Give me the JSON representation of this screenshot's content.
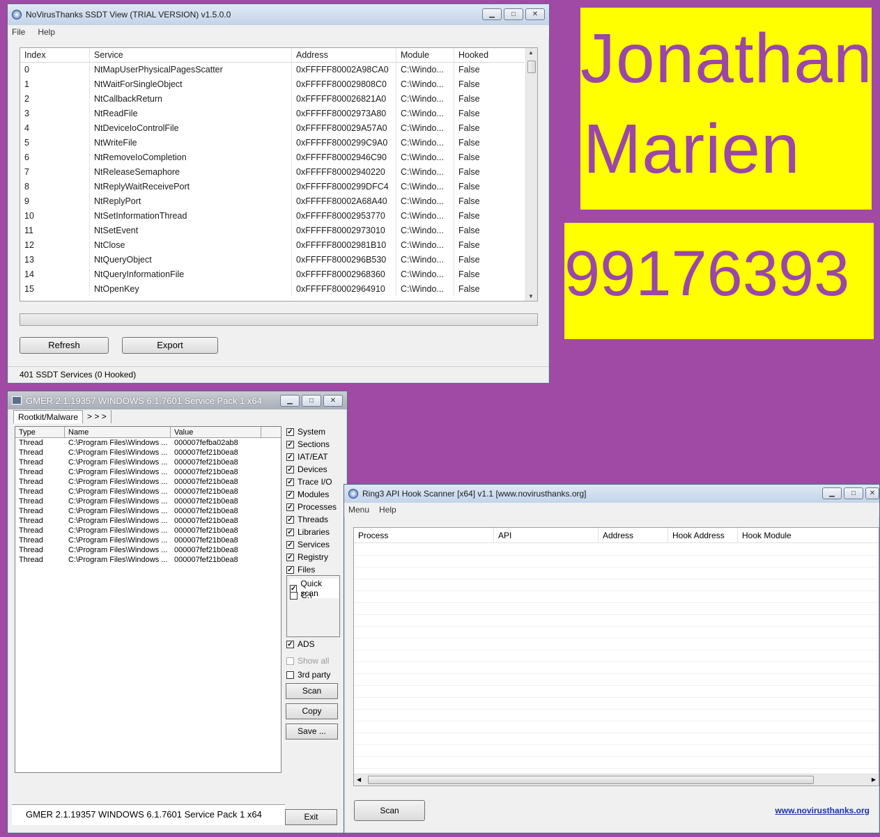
{
  "ssdt": {
    "title": "NoVirusThanks SSDT View (TRIAL VERSION) v1.5.0.0",
    "menu": [
      "File",
      "Help"
    ],
    "columns": [
      "Index",
      "Service",
      "Address",
      "Module",
      "Hooked"
    ],
    "rows": [
      [
        "0",
        "NtMapUserPhysicalPagesScatter",
        "0xFFFFF80002A98CA0",
        "C:\\Windo...",
        "False"
      ],
      [
        "1",
        "NtWaitForSingleObject",
        "0xFFFFF800029808C0",
        "C:\\Windo...",
        "False"
      ],
      [
        "2",
        "NtCallbackReturn",
        "0xFFFFF800026821A0",
        "C:\\Windo...",
        "False"
      ],
      [
        "3",
        "NtReadFile",
        "0xFFFFF80002973A80",
        "C:\\Windo...",
        "False"
      ],
      [
        "4",
        "NtDeviceIoControlFile",
        "0xFFFFF800029A57A0",
        "C:\\Windo...",
        "False"
      ],
      [
        "5",
        "NtWriteFile",
        "0xFFFFF8000299C9A0",
        "C:\\Windo...",
        "False"
      ],
      [
        "6",
        "NtRemoveIoCompletion",
        "0xFFFFF80002946C90",
        "C:\\Windo...",
        "False"
      ],
      [
        "7",
        "NtReleaseSemaphore",
        "0xFFFFF80002940220",
        "C:\\Windo...",
        "False"
      ],
      [
        "8",
        "NtReplyWaitReceivePort",
        "0xFFFFF8000299DFC4",
        "C:\\Windo...",
        "False"
      ],
      [
        "9",
        "NtReplyPort",
        "0xFFFFF80002A68A40",
        "C:\\Windo...",
        "False"
      ],
      [
        "10",
        "NtSetInformationThread",
        "0xFFFFF80002953770",
        "C:\\Windo...",
        "False"
      ],
      [
        "11",
        "NtSetEvent",
        "0xFFFFF80002973010",
        "C:\\Windo...",
        "False"
      ],
      [
        "12",
        "NtClose",
        "0xFFFFF80002981B10",
        "C:\\Windo...",
        "False"
      ],
      [
        "13",
        "NtQueryObject",
        "0xFFFFF8000296B530",
        "C:\\Windo...",
        "False"
      ],
      [
        "14",
        "NtQueryInformationFile",
        "0xFFFFF80002968360",
        "C:\\Windo...",
        "False"
      ],
      [
        "15",
        "NtOpenKey",
        "0xFFFFF80002964910",
        "C:\\Windo...",
        "False"
      ]
    ],
    "refresh_label": "Refresh",
    "export_label": "Export",
    "status": "401 SSDT Services (0 Hooked)"
  },
  "sign": {
    "line1": "Jonathan",
    "line2": "Marien",
    "number": "99176393"
  },
  "gmer": {
    "title": "GMER 2.1.19357    WINDOWS 6.1.7601 Service Pack 1 x64",
    "tab_main": "Rootkit/Malware",
    "tab_more": "> > >",
    "columns": [
      "Type",
      "Name",
      "Value"
    ],
    "rows": [
      [
        "Thread",
        "C:\\Program Files\\Windows ...",
        "000007fefba02ab8"
      ],
      [
        "Thread",
        "C:\\Program Files\\Windows ...",
        "000007fef21b0ea8"
      ],
      [
        "Thread",
        "C:\\Program Files\\Windows ...",
        "000007fef21b0ea8"
      ],
      [
        "Thread",
        "C:\\Program Files\\Windows ...",
        "000007fef21b0ea8"
      ],
      [
        "Thread",
        "C:\\Program Files\\Windows ...",
        "000007fef21b0ea8"
      ],
      [
        "Thread",
        "C:\\Program Files\\Windows ...",
        "000007fef21b0ea8"
      ],
      [
        "Thread",
        "C:\\Program Files\\Windows ...",
        "000007fef21b0ea8"
      ],
      [
        "Thread",
        "C:\\Program Files\\Windows ...",
        "000007fef21b0ea8"
      ],
      [
        "Thread",
        "C:\\Program Files\\Windows ...",
        "000007fef21b0ea8"
      ],
      [
        "Thread",
        "C:\\Program Files\\Windows ...",
        "000007fef21b0ea8"
      ],
      [
        "Thread",
        "C:\\Program Files\\Windows ...",
        "000007fef21b0ea8"
      ],
      [
        "Thread",
        "C:\\Program Files\\Windows ...",
        "000007fef21b0ea8"
      ],
      [
        "Thread",
        "C:\\Program Files\\Windows ...",
        "000007fef21b0ea8"
      ]
    ],
    "options": [
      "System",
      "Sections",
      "IAT/EAT",
      "Devices",
      "Trace I/O",
      "Modules",
      "Processes",
      "Threads",
      "Libraries",
      "Services",
      "Registry",
      "Files"
    ],
    "quick_scan": "Quick scan",
    "drive_c": "C:\\",
    "ads": "ADS",
    "show_all": "Show all",
    "third_party": "3rd party",
    "scan_label": "Scan",
    "copy_label": "Copy",
    "save_label": "Save ...",
    "status": "GMER 2.1.19357    WINDOWS 6.1.7601 Service Pack 1 x64",
    "exit_label": "Exit"
  },
  "ring3": {
    "title": "Ring3 API Hook Scanner [x64] v1.1 [www.novirusthanks.org]",
    "menu": [
      "Menu",
      "Help"
    ],
    "columns": [
      "Process",
      "API",
      "Address",
      "Hook Address",
      "Hook Module"
    ],
    "scan_label": "Scan",
    "link": "www.novirusthanks.org"
  }
}
